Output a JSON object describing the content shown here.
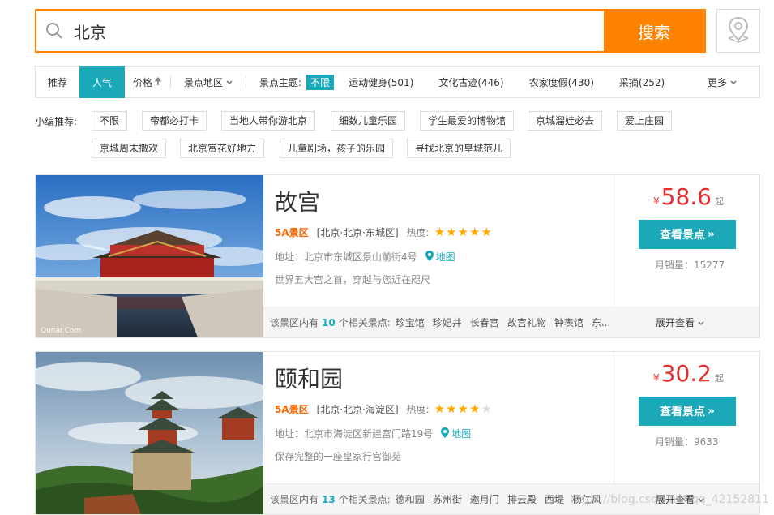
{
  "search": {
    "value": "北京",
    "button_label": "搜索"
  },
  "sort": {
    "recommend": "推荐",
    "popular": "人气",
    "price": "价格",
    "region": "景点地区"
  },
  "theme": {
    "label": "景点主题:",
    "active": "不限",
    "options": [
      "运动健身(501)",
      "文化古迹(446)",
      "农家度假(430)",
      "采摘(252)"
    ],
    "more": "更多"
  },
  "recommend": {
    "label": "小编推荐:",
    "tags_row1": [
      "不限",
      "帝都必打卡",
      "当地人带你游北京",
      "细数儿童乐园",
      "学生最爱的博物馆",
      "京城溜娃必去",
      "爱上庄园"
    ],
    "tags_row2": [
      "京城周末撒欢",
      "北京赏花好地方",
      "儿童剧场，孩子的乐园",
      "寻找北京的皇城范儿"
    ]
  },
  "results": [
    {
      "name": "故宫",
      "level": "5A景区",
      "region": "[北京·北京·东城区]",
      "hot_label": "热度:",
      "rating": 5,
      "address": "地址：北京市东城区景山前街4号",
      "map_label": "地图",
      "desc": "世界五大宫之首，穿越与您近在咫尺",
      "currency": "¥",
      "price": "58.6",
      "price_suffix": "起",
      "button": "查看景点",
      "sales": "月销量：15277",
      "foot_prefix": "该景区内有",
      "foot_count": "10",
      "foot_suffix": "个相关景点:",
      "spots": [
        "珍宝馆",
        "珍妃井",
        "长春宫",
        "故宫礼物",
        "钟表馆",
        "东..."
      ],
      "expand": "展开查看",
      "photo_credit": "Qunar.Com"
    },
    {
      "name": "颐和园",
      "level": "5A景区",
      "region": "[北京·北京·海淀区]",
      "hot_label": "热度:",
      "rating": 4,
      "address": "地址：北京市海淀区新建宫门路19号",
      "map_label": "地图",
      "desc": "保存完整的一座皇家行宫御苑",
      "currency": "¥",
      "price": "30.2",
      "price_suffix": "起",
      "button": "查看景点",
      "sales": "月销量：9633",
      "foot_prefix": "该景区内有",
      "foot_count": "13",
      "foot_suffix": "个相关景点:",
      "spots": [
        "德和园",
        "苏州街",
        "邀月门",
        "排云殿",
        "西堤",
        "杨仁风"
      ],
      "expand": "展开查看"
    }
  ],
  "watermark": "https://blog.csdn.net/qq_42152811",
  "colors": {
    "accent_orange": "#ff8300",
    "accent_teal": "#1ba9ba",
    "price_red": "#e62e2e",
    "star_gold": "#ffa800"
  }
}
